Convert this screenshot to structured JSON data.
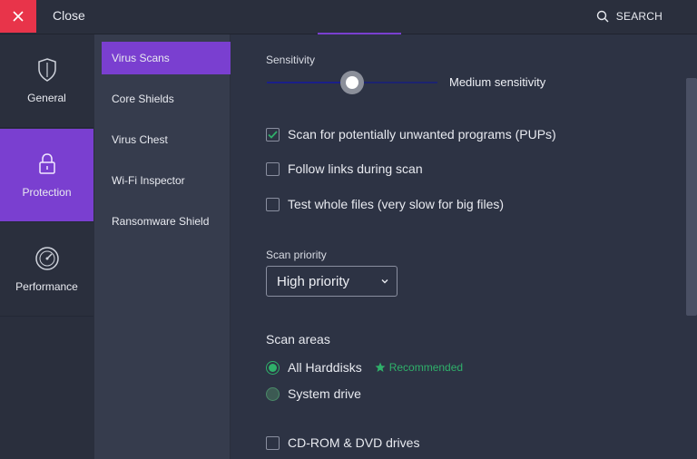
{
  "topbar": {
    "close_label": "Close",
    "search_label": "SEARCH"
  },
  "leftnav": {
    "items": [
      {
        "label": "General",
        "icon": "shield-icon",
        "active": false
      },
      {
        "label": "Protection",
        "icon": "lock-icon",
        "active": true
      },
      {
        "label": "Performance",
        "icon": "speedometer-icon",
        "active": false
      }
    ]
  },
  "subnav": {
    "items": [
      {
        "label": "Virus Scans",
        "active": true
      },
      {
        "label": "Core Shields",
        "active": false
      },
      {
        "label": "Virus Chest",
        "active": false
      },
      {
        "label": "Wi-Fi Inspector",
        "active": false
      },
      {
        "label": "Ransomware Shield",
        "active": false
      }
    ]
  },
  "content": {
    "sensitivity": {
      "label": "Sensitivity",
      "value_label": "Medium sensitivity",
      "level": 0.5
    },
    "checks": [
      {
        "label": "Scan for potentially unwanted programs (PUPs)",
        "checked": true
      },
      {
        "label": "Follow links during scan",
        "checked": false
      },
      {
        "label": "Test whole files (very slow for big files)",
        "checked": false
      }
    ],
    "scan_priority": {
      "label": "Scan priority",
      "selected": "High priority"
    },
    "scan_areas": {
      "title": "Scan areas",
      "options": [
        {
          "label": "All Harddisks",
          "checked": true,
          "badge": "Recommended"
        },
        {
          "label": "System drive",
          "checked": false
        }
      ]
    },
    "extra_checks": [
      {
        "label": "CD-ROM & DVD drives",
        "checked": false
      }
    ]
  },
  "colors": {
    "accent": "#7a3fd0",
    "close": "#e8344a",
    "success": "#2fb06a"
  }
}
